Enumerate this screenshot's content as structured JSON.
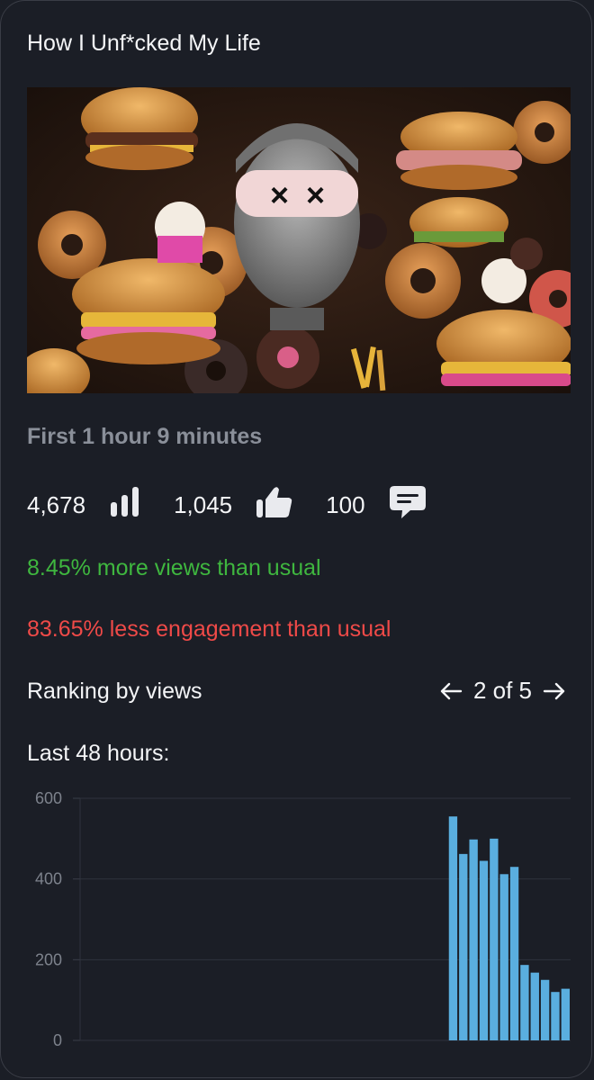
{
  "post": {
    "title": "How I Unf*cked My Life",
    "thumbnail_alt": "Thumbnail: mannequin head with X-eye mask surrounded by burgers and donuts"
  },
  "period": "First 1 hour 9 minutes",
  "stats": {
    "views": "4,678",
    "likes": "1,045",
    "comments": "100"
  },
  "comparison": {
    "views_text": "8.45% more views than usual",
    "engagement_text": "83.65% less engagement than usual"
  },
  "ranking": {
    "label": "Ranking by views",
    "position": "2 of 5"
  },
  "chart_label": "Last 48 hours:",
  "colors": {
    "positive": "#3fb73f",
    "negative": "#ef4a48",
    "bar": "#5aaedf"
  },
  "icons": [
    "bar-chart-icon",
    "thumbs-up-icon",
    "comment-icon",
    "arrow-left-icon",
    "arrow-right-icon"
  ],
  "chart_data": {
    "type": "bar",
    "ylim": [
      0,
      600
    ],
    "yticks": [
      0,
      200,
      400,
      600
    ],
    "grid": true,
    "bars_total": 48,
    "values": [
      0,
      0,
      0,
      0,
      0,
      0,
      0,
      0,
      0,
      0,
      0,
      0,
      0,
      0,
      0,
      0,
      0,
      0,
      0,
      0,
      0,
      0,
      0,
      0,
      0,
      0,
      0,
      0,
      0,
      0,
      0,
      0,
      0,
      0,
      0,
      0,
      555,
      462,
      498,
      445,
      500,
      412,
      430,
      187,
      168,
      150,
      120,
      128
    ]
  }
}
